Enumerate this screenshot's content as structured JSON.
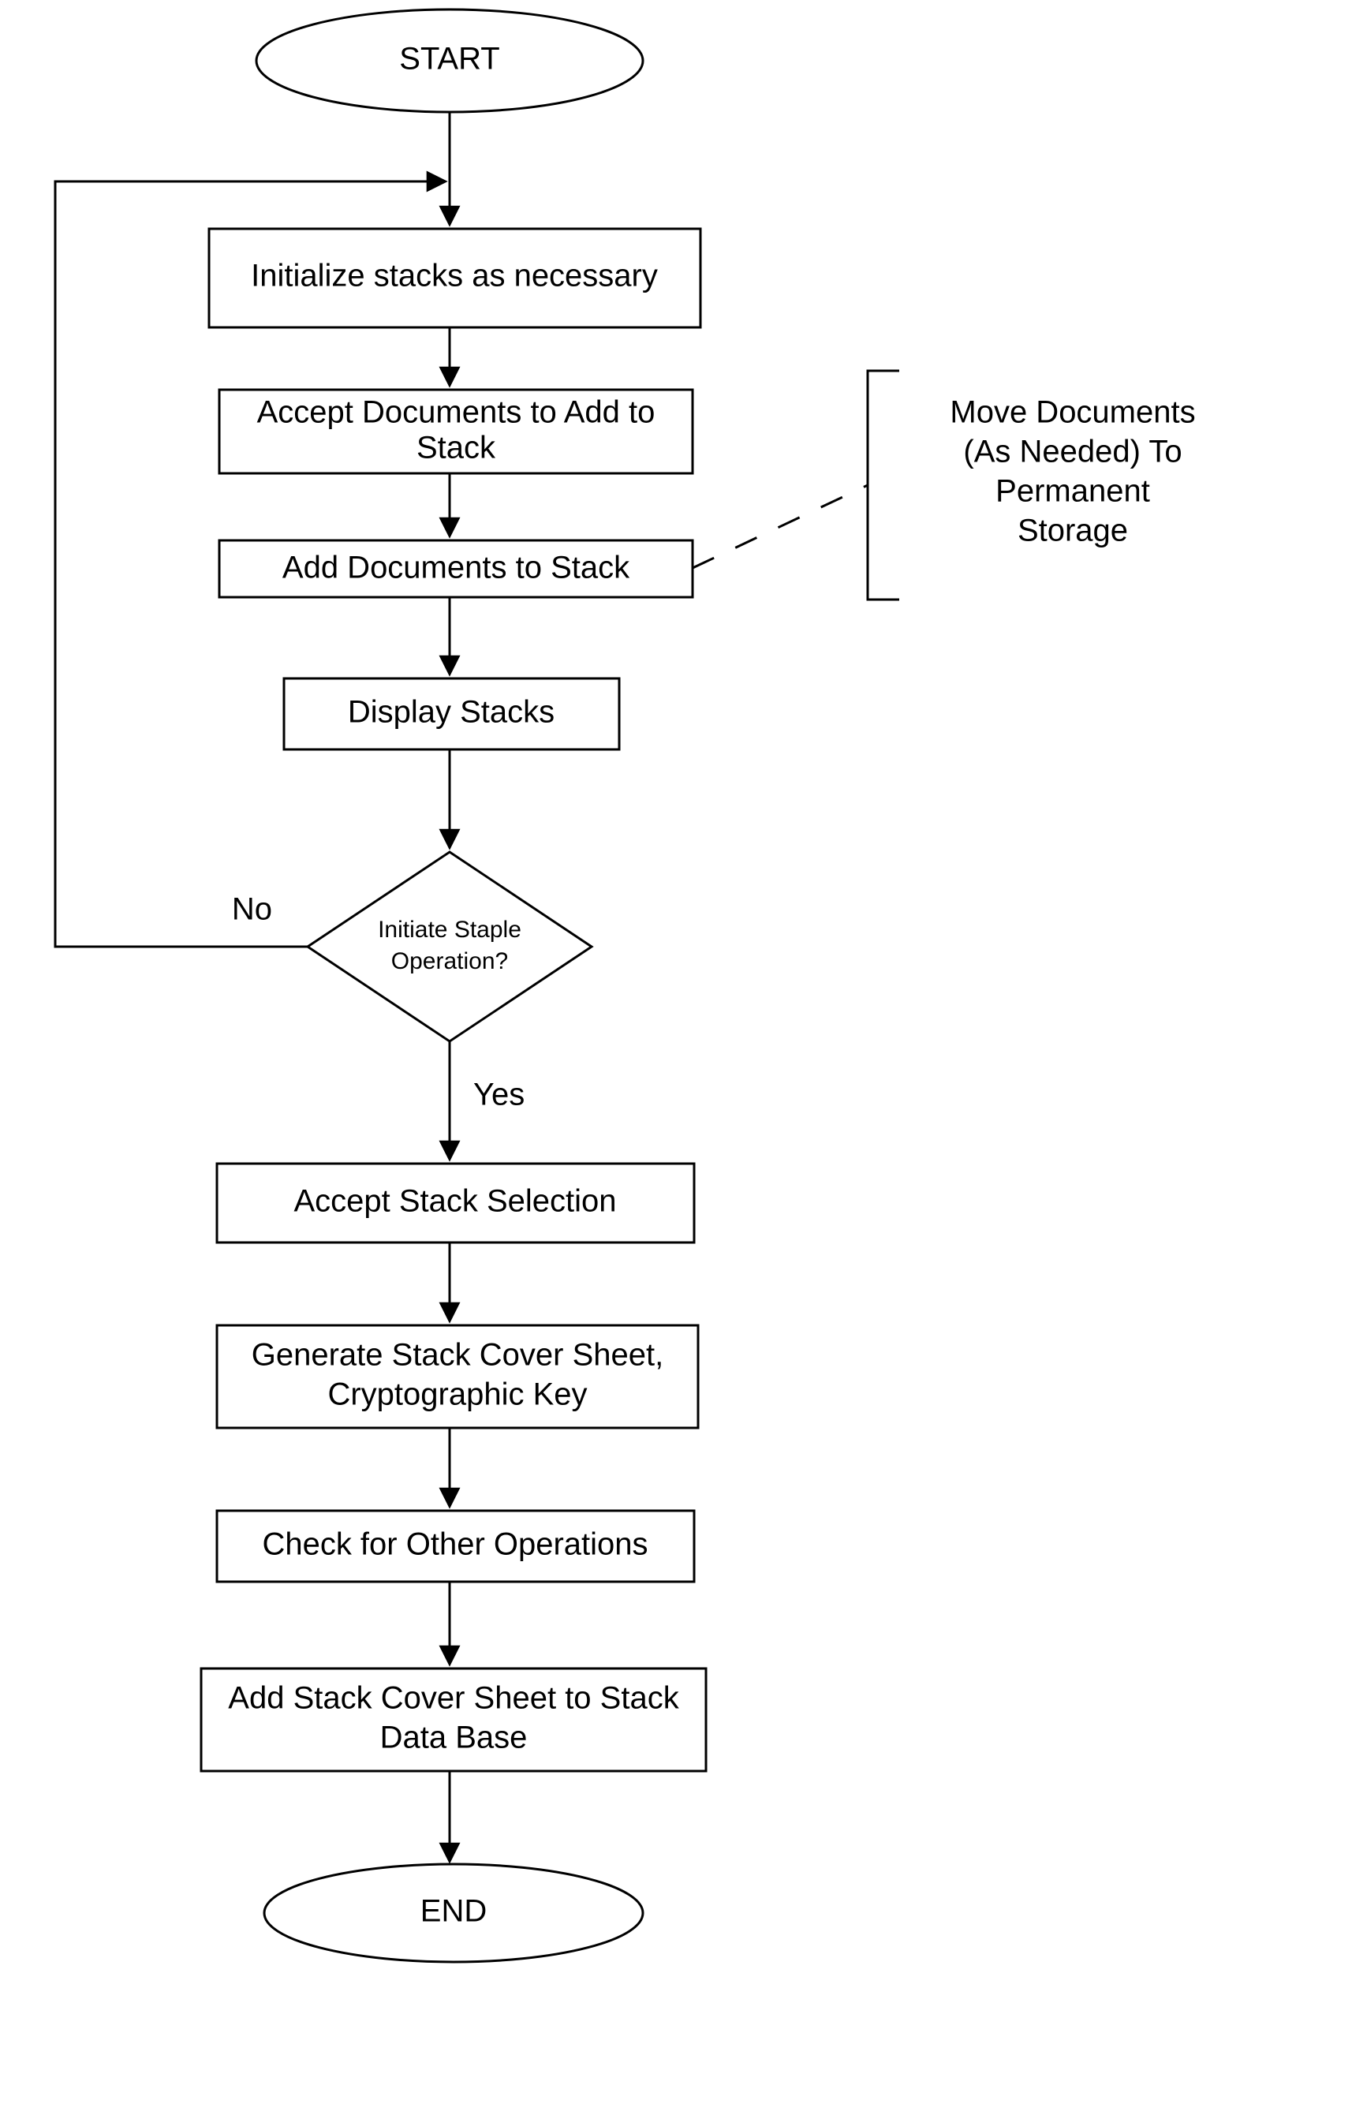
{
  "nodes": {
    "start": {
      "label": "START"
    },
    "init": {
      "label": "Initialize stacks as necessary"
    },
    "accept": {
      "line1": "Accept Documents to Add to",
      "line2": "Stack"
    },
    "add": {
      "label": "Add Documents to Stack"
    },
    "display": {
      "label": "Display Stacks"
    },
    "decision": {
      "line1": "Initiate Staple",
      "line2": "Operation?"
    },
    "select": {
      "label": "Accept Stack Selection"
    },
    "gen": {
      "line1": "Generate Stack Cover Sheet,",
      "line2": "Cryptographic Key"
    },
    "check": {
      "label": "Check for Other Operations"
    },
    "adddb": {
      "line1": "Add Stack Cover Sheet to Stack",
      "line2": "Data Base"
    },
    "end": {
      "label": "END"
    }
  },
  "annotations": {
    "move": {
      "line1": "Move Documents",
      "line2": "(As Needed) To",
      "line3": "Permanent",
      "line4": "Storage"
    }
  },
  "edges": {
    "no": "No",
    "yes": "Yes"
  }
}
